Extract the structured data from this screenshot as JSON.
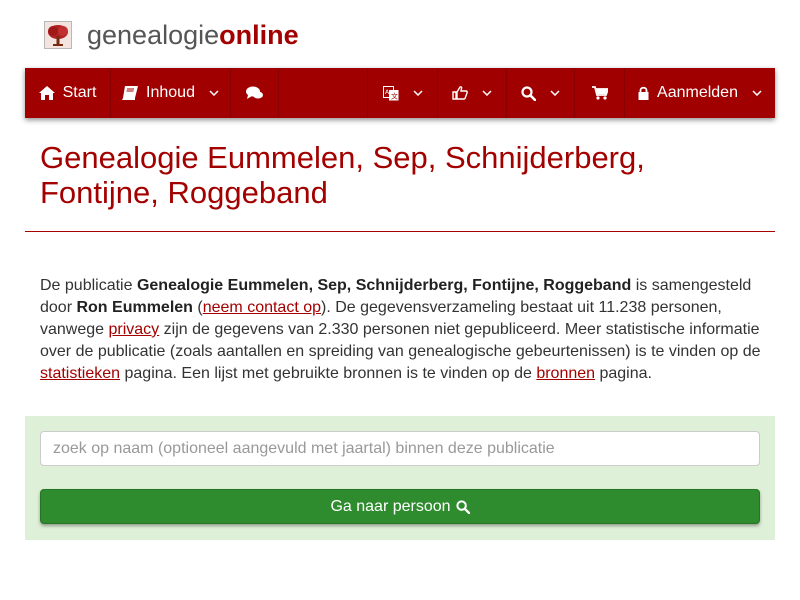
{
  "logo": {
    "icon": "tree-icon",
    "text_plain": "genealogie",
    "text_accent": "online"
  },
  "nav": {
    "start_label": "Start",
    "start_icon": "home-icon",
    "inhoud_label": "Inhoud",
    "inhoud_icon": "book-icon",
    "chat_icon": "comments-icon",
    "language_icon": "translate-icon",
    "like_icon": "thumbs-up-icon",
    "search_icon": "search-icon",
    "cart_icon": "shopping-cart-icon",
    "login_label": "Aanmelden",
    "login_icon": "lock-icon"
  },
  "page": {
    "title": "Genealogie Eummelen, Sep, Schnijderberg, Fontijne, Roggeband"
  },
  "description": {
    "p1": "De publicatie ",
    "pub_name": "Genealogie Eummelen, Sep, Schnijderberg, Fontijne, Roggeband",
    "p2": " is samengesteld door ",
    "author": "Ron Eummelen",
    "p3": " (",
    "contact_link": "neem contact op",
    "p4": "). De gegevensverzameling bestaat uit 11.238 personen, vanwege ",
    "privacy_link": "privacy",
    "p5": " zijn de gegevens van 2.330 personen niet gepubliceerd. Meer statistische informatie over de publicatie (zoals aantallen en spreiding van genealogische gebeurtenissen) is te vinden op de ",
    "stats_link": "statistieken",
    "p6": " pagina. Een lijst met gebruikte bronnen is te vinden op de ",
    "sources_link": "bronnen",
    "p7": " pagina."
  },
  "search": {
    "placeholder": "zoek op naam (optioneel aangevuld met jaartal) binnen deze publicatie",
    "value": "",
    "button_label": "Ga naar persoon ",
    "button_icon": "search-icon"
  },
  "colors": {
    "brand_red": "#a00000",
    "accent_text": "#a30000",
    "panel_bg": "#dff0d8",
    "button_green": "#2e8b2e"
  }
}
